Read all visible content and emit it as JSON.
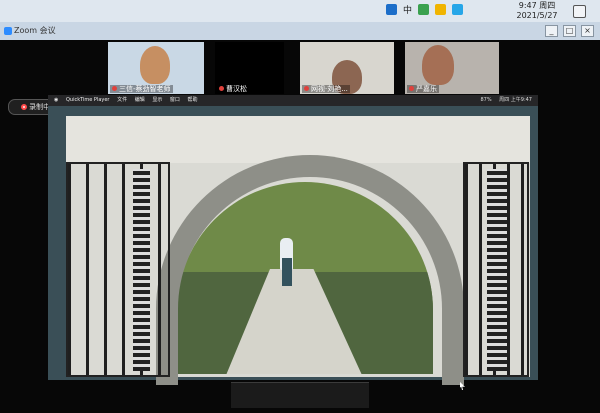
{
  "taskbar": {
    "time": "9:47 周四",
    "date": "2021/5/27",
    "lang": "中"
  },
  "window": {
    "title": "Zoom 会议"
  },
  "participants": [
    {
      "name": "三信-蔡劲智老师"
    },
    {
      "name": "曹汉松"
    },
    {
      "name": "网视·刘艳..."
    },
    {
      "name": "严嘉乐"
    }
  ],
  "recording": {
    "label": "录制中..."
  },
  "shared_screen": {
    "menu": [
      "QuickTime Player",
      "文件",
      "编辑",
      "显示",
      "窗口",
      "帮助"
    ],
    "status": "周四 上午9:47",
    "battery": "87%"
  },
  "colors": {
    "accent": "#2d8cff",
    "recording": "#ff4b4b"
  }
}
